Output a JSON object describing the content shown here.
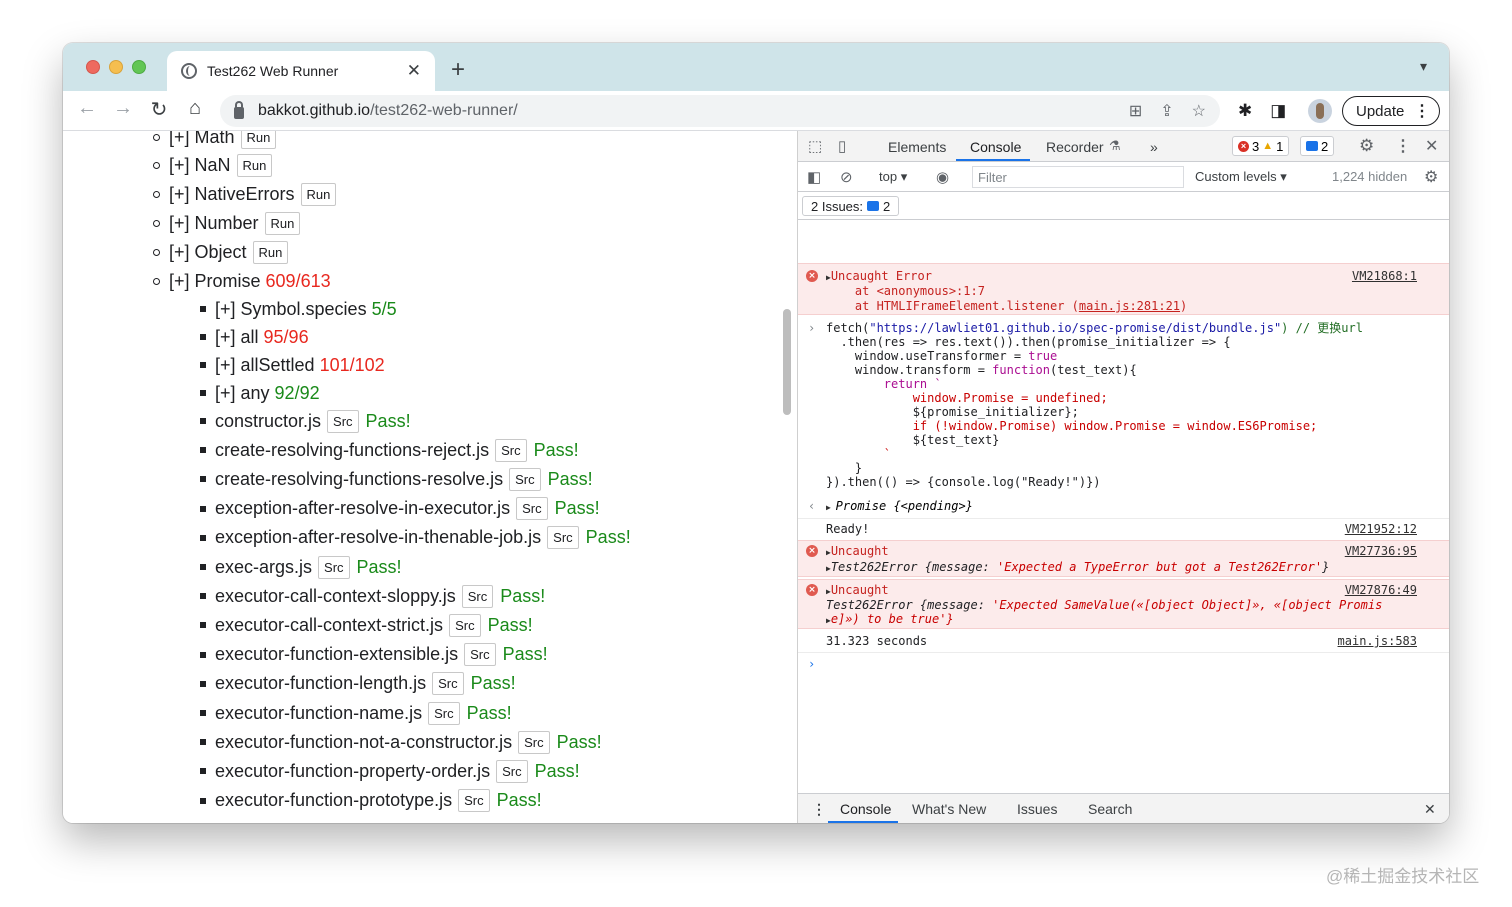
{
  "browser": {
    "tab_title": "Test262 Web Runner",
    "new_tab": "+",
    "tabs_menu": "⌄",
    "url_host": "bakkot.github.io",
    "url_path": "/test262-web-runner/",
    "update_label": "Update",
    "menu_dots": "⋮"
  },
  "page": {
    "rows": [
      {
        "label": "[+] Math",
        "btn": "Run"
      },
      {
        "label": "[+] NaN",
        "btn": "Run"
      },
      {
        "label": "[+] NativeErrors",
        "btn": "Run"
      },
      {
        "label": "[+] Number",
        "btn": "Run"
      },
      {
        "label": "[+] Object",
        "btn": "Run"
      },
      {
        "label": "[+] Promise",
        "count": "609/613"
      }
    ],
    "promise_children": [
      {
        "label": "[+] Symbol.species",
        "count": "5/5"
      },
      {
        "label": "[+] all",
        "count": "95/96"
      },
      {
        "label": "[+] allSettled",
        "count": "101/102"
      },
      {
        "label": "[+] any",
        "count": "92/92"
      }
    ],
    "src_label": "Src",
    "pass_label": "Pass!",
    "files": [
      "constructor.js",
      "create-resolving-functions-reject.js",
      "create-resolving-functions-resolve.js",
      "exception-after-resolve-in-executor.js",
      "exception-after-resolve-in-thenable-job.js",
      "exec-args.js",
      "executor-call-context-sloppy.js",
      "executor-call-context-strict.js",
      "executor-function-extensible.js",
      "executor-function-length.js",
      "executor-function-name.js",
      "executor-function-not-a-constructor.js",
      "executor-function-property-order.js",
      "executor-function-prototype.js"
    ]
  },
  "devtools": {
    "tabs": {
      "elements": "Elements",
      "console": "Console",
      "recorder": "Recorder",
      "more": "»"
    },
    "errors_count": "3",
    "warnings_count": "1",
    "messages_count": "2",
    "context": "top",
    "filter_placeholder": "Filter",
    "levels": "Custom levels",
    "hidden": "1,224 hidden",
    "issues_label": "2 Issues:",
    "issues_count": "2",
    "console": {
      "err1_title": "Uncaught Error",
      "err1_line2": "    at <anonymous>:1:7",
      "err1_line3a": "    at HTMLIFrameElement.listener (",
      "err1_line3_link": "main.js:281:21",
      "err1_line3b": ")",
      "err1_src": "VM21868:1",
      "code_l1a": "fetch(",
      "code_l1_str": "\"https://lawliet01.github.io/spec-promise/dist/bundle.js\"",
      "code_l1_comment": ") // 更换url",
      "code_l2": "  .then(res => res.text()).then(promise_initializer => {",
      "code_l3a": "    window.useTransformer = ",
      "code_l3_true": "true",
      "code_l4a": "    window.transform = ",
      "code_l4_fn": "function",
      "code_l4b": "(test_text){",
      "code_l5": "        return `",
      "code_l6": "            window.Promise = undefined;",
      "code_l7": "            ${promise_initializer};",
      "code_l8": "            if (!window.Promise) window.Promise = window.ES6Promise;",
      "code_l9": "            ${test_text}",
      "code_l10": "        `",
      "code_l11": "    }",
      "code_l12": "}).then(() => {console.log(\"Ready!\")})",
      "promise_result": "Promise {<pending>}",
      "ready": "Ready!",
      "ready_src": "VM21952:12",
      "err2_title": "Uncaught",
      "err2_src": "VM27736:95",
      "err2_detail_a": "Test262Error {message: ",
      "err2_detail_b": "'Expected a TypeError but got a Test262Error'",
      "err2_detail_c": "}",
      "err3_title": "Uncaught",
      "err3_src": "VM27876:49",
      "err3_detail_a": "Test262Error {message: ",
      "err3_detail_b": "'Expected SameValue(«[object Object]», «[object Promis",
      "err3_detail_c": "e]») to be true'}",
      "timing": "31.323 seconds",
      "timing_src": "main.js:583"
    },
    "drawer": {
      "console": "Console",
      "whats_new": "What's New",
      "issues": "Issues",
      "search": "Search"
    }
  },
  "watermark": "@稀土掘金技术社区"
}
